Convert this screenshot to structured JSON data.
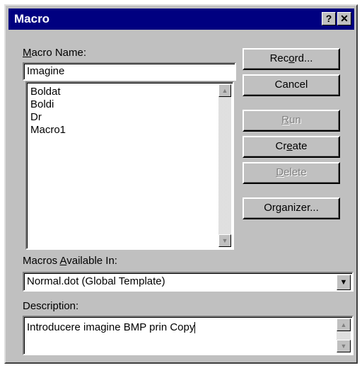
{
  "dialog": {
    "title": "Macro",
    "help_glyph": "?",
    "close_glyph": "✕"
  },
  "macro_name": {
    "label_pre": "",
    "label_key": "M",
    "label_post": "acro Name:",
    "value": "Imagine"
  },
  "macro_list": {
    "items": [
      "Boldat",
      "Boldi",
      "Dr",
      "Macro1"
    ]
  },
  "buttons": {
    "record": {
      "pre": "Rec",
      "key": "o",
      "post": "rd...",
      "enabled": true
    },
    "cancel": {
      "pre": "Cancel",
      "key": "",
      "post": "",
      "enabled": true
    },
    "run": {
      "pre": "",
      "key": "R",
      "post": "un",
      "enabled": false
    },
    "create": {
      "pre": "Cr",
      "key": "e",
      "post": "ate",
      "enabled": true
    },
    "delete": {
      "pre": "",
      "key": "D",
      "post": "elete",
      "enabled": false
    },
    "organizer": {
      "pre": "Or",
      "key": "g",
      "post": "anizer...",
      "enabled": true
    }
  },
  "available_in": {
    "label_pre": "Macros ",
    "label_key": "A",
    "label_post": "vailable In:",
    "value": "Normal.dot (Global Template)"
  },
  "description": {
    "label": "Description:",
    "value": "Introducere imagine BMP prin Copy"
  },
  "icons": {
    "scroll_up": "up-arrow",
    "scroll_down": "down-arrow",
    "dropdown": "down-triangle"
  }
}
